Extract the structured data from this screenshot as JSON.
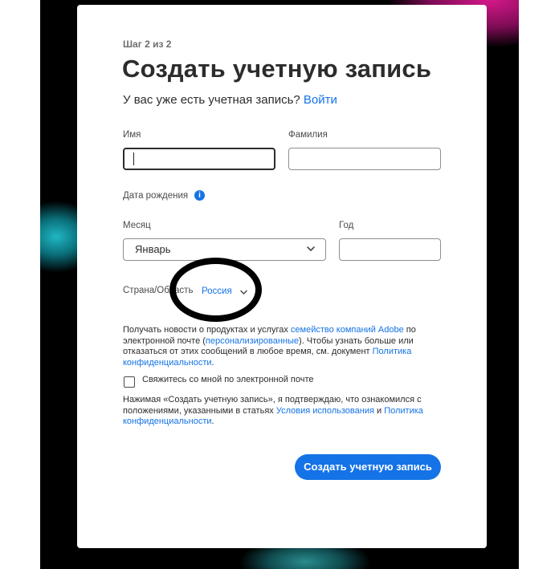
{
  "background": {
    "accent_pink": "#d6188a",
    "accent_teal": "#1fb7c4"
  },
  "form": {
    "step": "Шаг 2 из 2",
    "title": "Создать учетную запись",
    "have_account_text": "У вас уже есть учетная запись?",
    "sign_in_link": "Войти",
    "first_name": {
      "label": "Имя",
      "value": ""
    },
    "last_name": {
      "label": "Фамилия",
      "value": ""
    },
    "birth_date_label": "Дата рождения",
    "info_icon_glyph": "i",
    "month": {
      "label": "Месяц",
      "value": "Январь"
    },
    "year": {
      "label": "Год",
      "value": ""
    },
    "country": {
      "label": "Страна/Область",
      "value": "Россия"
    },
    "news": {
      "line1_pre": "Получать новости о продуктах и услугах ",
      "line1_link": "семейство компаний Adobe",
      "line1_post": " по",
      "line2_pre": "электронной почте (",
      "line2_link": "персонализированные",
      "line2_post": "). Чтобы узнать больше или",
      "line3_pre": "отказаться от этих сообщений в любое время, см. документ ",
      "line3_link": "Политика",
      "line4_link": "конфиденциальности",
      "line4_post": "."
    },
    "contact_checkbox_label": "Свяжитесь со мной по электронной почте",
    "terms": {
      "line1": "Нажимая «Создать учетную запись», я подтверждаю, что ознакомился с",
      "line2_pre": "положениями, указанными в статьях ",
      "line2_link1": "Условия использования",
      "line2_mid": " и ",
      "line2_link2": "Политика",
      "line3_link": "конфиденциальности",
      "line3_post": "."
    },
    "submit_label": "Создать учетную запись",
    "accent_color": "#1473e6"
  }
}
